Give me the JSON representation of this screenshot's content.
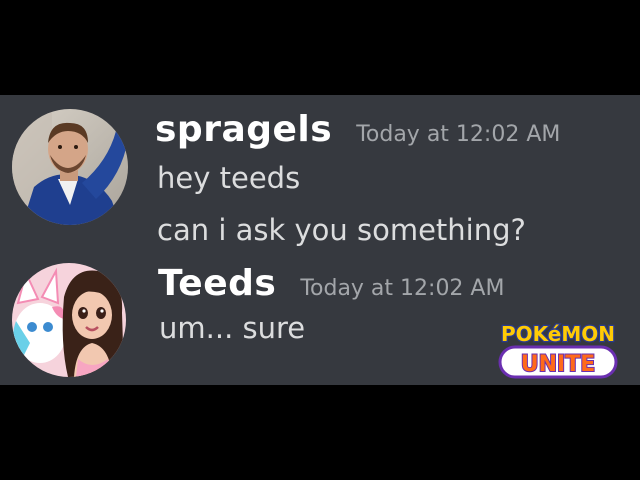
{
  "messages": [
    {
      "username": "spragels",
      "timestamp": "Today at 12:02 AM",
      "lines": [
        "hey teeds",
        "can i ask you something?"
      ]
    },
    {
      "username": "Teeds",
      "timestamp": "Today at 12:02 AM",
      "lines": [
        "um... sure"
      ]
    }
  ],
  "logo": {
    "top_text": "POKéMON",
    "bottom_text": "UNITE"
  },
  "colors": {
    "background": "#000000",
    "chat_background": "#36393f",
    "username": "#ffffff",
    "timestamp": "#a3a6aa",
    "message_text": "#dcddde",
    "logo_yellow": "#ffcb05",
    "logo_purple": "#6a2fb0"
  }
}
